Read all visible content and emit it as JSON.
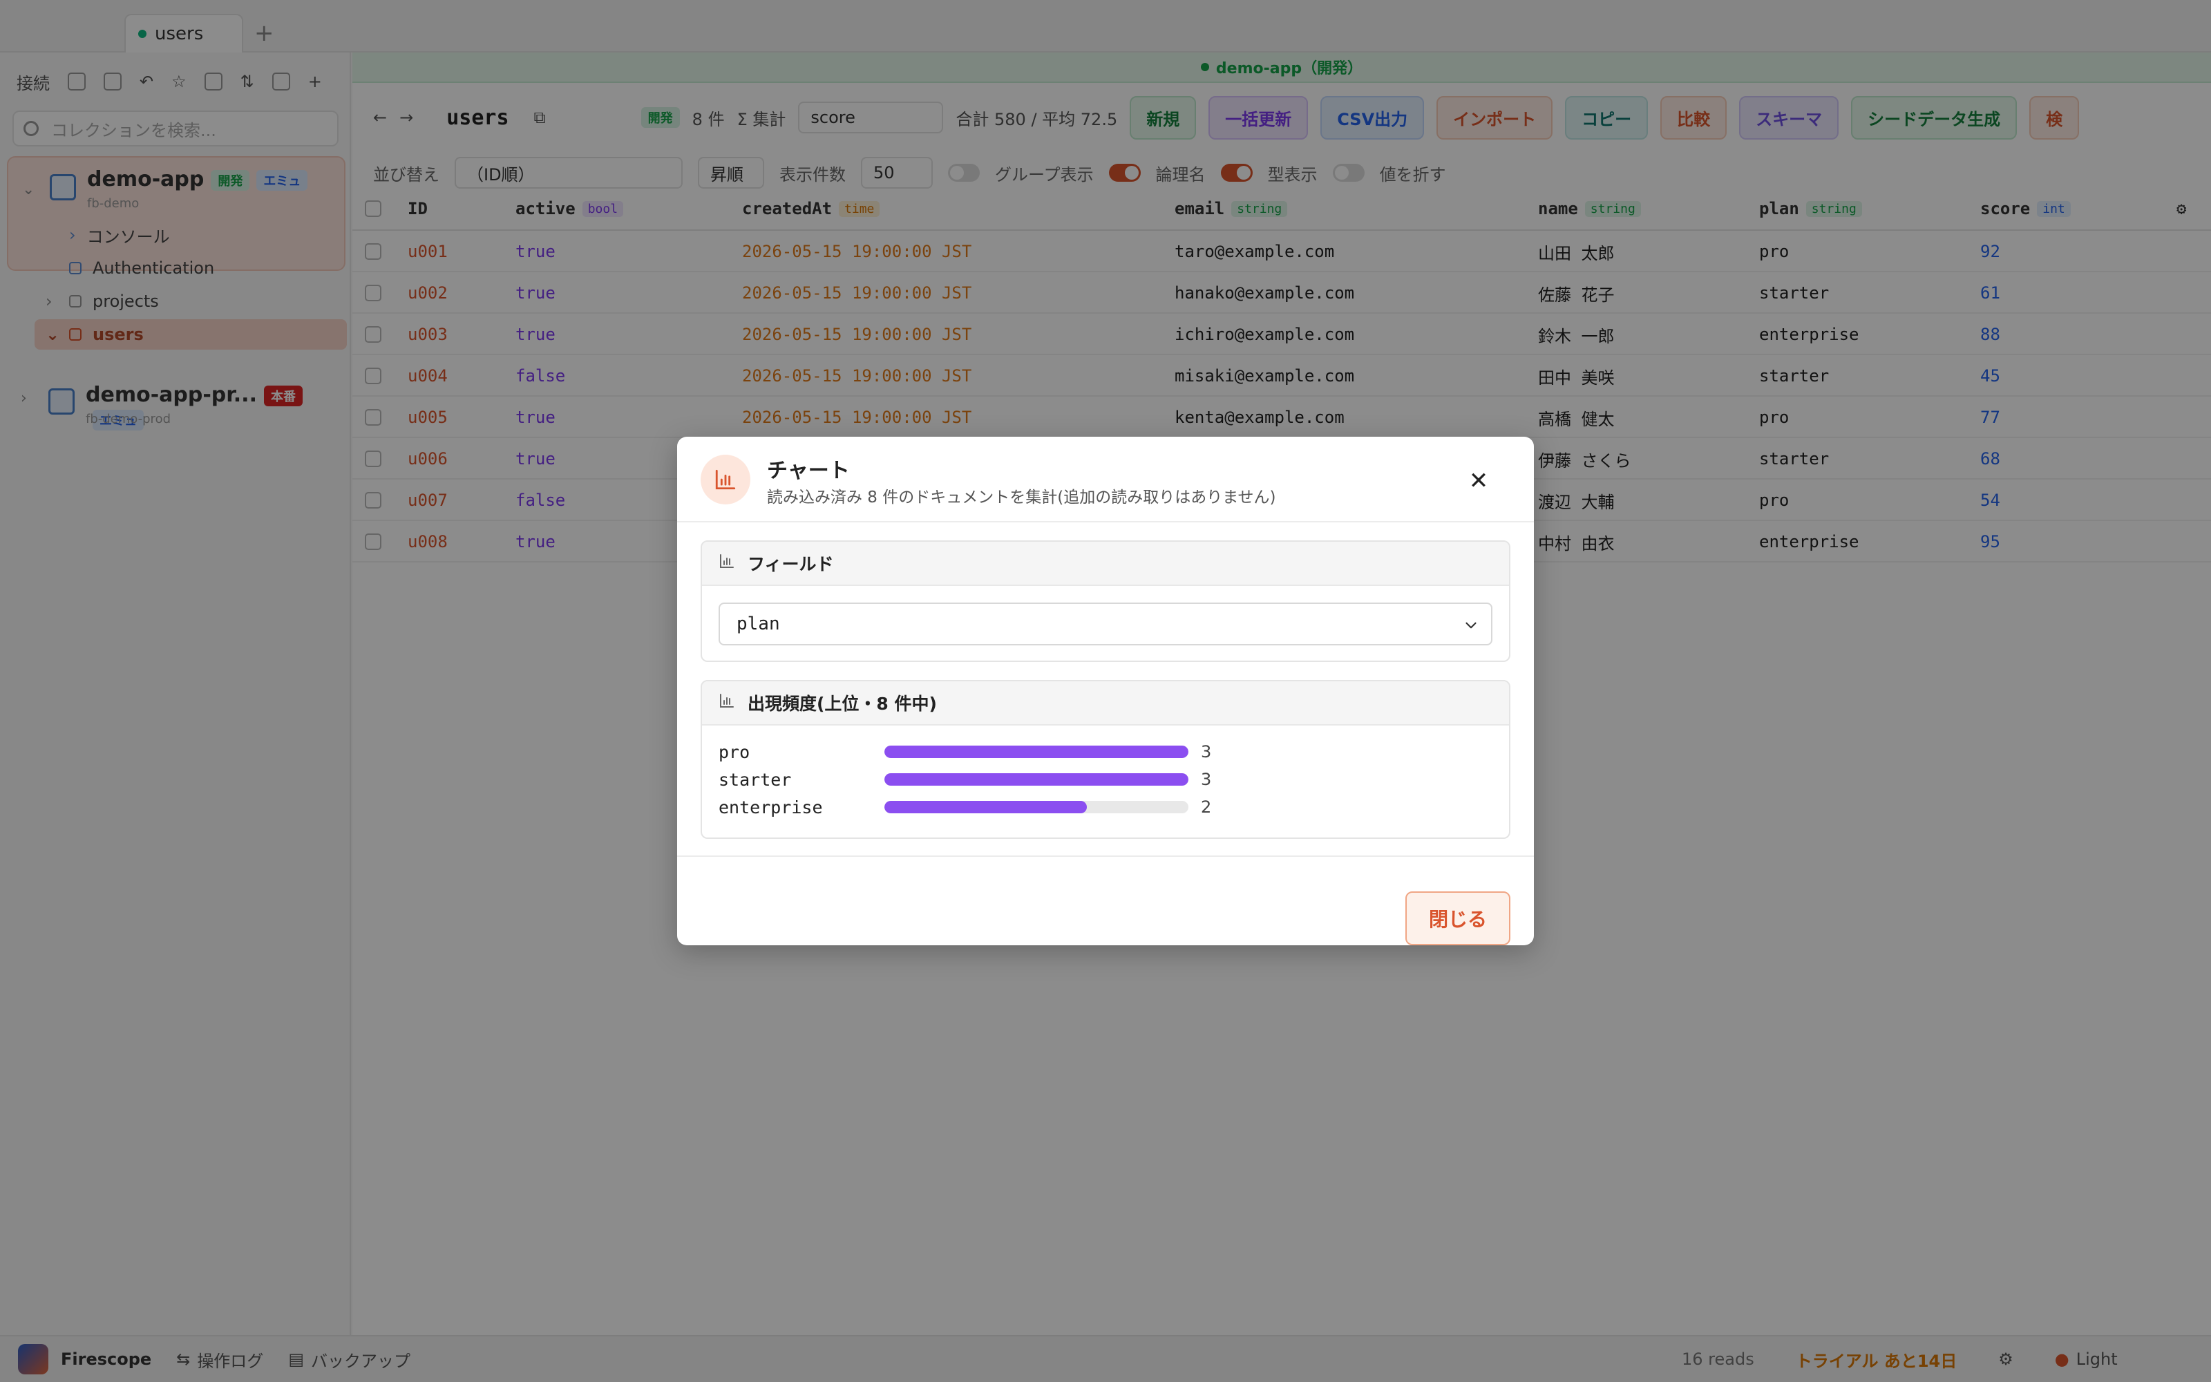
{
  "tabs": [
    {
      "label": "users"
    }
  ],
  "sidebar": {
    "toolbar_label": "接続",
    "search_placeholder": "コレクションを検索...",
    "projects": [
      {
        "name": "demo-app",
        "id": "fb-demo",
        "badges": [
          "開発",
          "エミュ"
        ]
      },
      {
        "name": "demo-app-pr...",
        "id": "fb-demo-prod",
        "badges": [
          "本番",
          "エミュ"
        ]
      }
    ],
    "tree": [
      {
        "label": "コンソール"
      },
      {
        "label": "Authentication"
      },
      {
        "label": "projects"
      },
      {
        "label": "users"
      }
    ]
  },
  "main": {
    "env_label": "demo-app（開発）",
    "collection_title": "users",
    "mode_badge": "開発",
    "doc_count": "8 件",
    "aggregate_label": "Σ 集計",
    "aggregate_field": "score",
    "aggregate_summary": "合計 580 / 平均 72.5",
    "actions": [
      "新規",
      "一括更新",
      "CSV出力",
      "インポート",
      "コピー",
      "比較",
      "スキーマ",
      "シードデータ生成",
      "検"
    ],
    "sort_label": "並び替え",
    "sort_value": "（ID順）",
    "order_value": "昇順",
    "page_size_label": "表示件数",
    "page_size_value": "50",
    "toggles": [
      {
        "label": "グループ表示",
        "on": false
      },
      {
        "label": "論理名",
        "on": true
      },
      {
        "label": "型表示",
        "on": true
      },
      {
        "label": "値を折す",
        "on": false
      }
    ],
    "columns": [
      {
        "name": "ID",
        "type": ""
      },
      {
        "name": "active",
        "type": "bool"
      },
      {
        "name": "createdAt",
        "type": "time"
      },
      {
        "name": "email",
        "type": "string"
      },
      {
        "name": "name",
        "type": "string"
      },
      {
        "name": "plan",
        "type": "string"
      },
      {
        "name": "score",
        "type": "int"
      }
    ],
    "rows": [
      {
        "id": "u001",
        "active": "true",
        "createdAt": "2026-05-15 19:00:00 JST",
        "email": "taro@example.com",
        "name": "山田 太郎",
        "plan": "pro",
        "score": "92"
      },
      {
        "id": "u002",
        "active": "true",
        "createdAt": "2026-05-15 19:00:00 JST",
        "email": "hanako@example.com",
        "name": "佐藤 花子",
        "plan": "starter",
        "score": "61"
      },
      {
        "id": "u003",
        "active": "true",
        "createdAt": "2026-05-15 19:00:00 JST",
        "email": "ichiro@example.com",
        "name": "鈴木 一郎",
        "plan": "enterprise",
        "score": "88"
      },
      {
        "id": "u004",
        "active": "false",
        "createdAt": "2026-05-15 19:00:00 JST",
        "email": "misaki@example.com",
        "name": "田中 美咲",
        "plan": "starter",
        "score": "45"
      },
      {
        "id": "u005",
        "active": "true",
        "createdAt": "2026-05-15 19:00:00 JST",
        "email": "kenta@example.com",
        "name": "高橋 健太",
        "plan": "pro",
        "score": "77"
      },
      {
        "id": "u006",
        "active": "true",
        "createdAt": "",
        "email": "",
        "name": "伊藤 さくら",
        "plan": "starter",
        "score": "68"
      },
      {
        "id": "u007",
        "active": "false",
        "createdAt": "",
        "email": "",
        "name": "渡辺 大輔",
        "plan": "pro",
        "score": "54"
      },
      {
        "id": "u008",
        "active": "true",
        "createdAt": "",
        "email": "",
        "name": "中村 由衣",
        "plan": "enterprise",
        "score": "95"
      }
    ]
  },
  "statusbar": {
    "app_name": "Firescope",
    "ops_log": "操作ログ",
    "backup": "バックアップ",
    "reads": "16 reads",
    "trial": "トライアル あと14日",
    "theme": "Light"
  },
  "modal": {
    "title": "チャート",
    "subtitle": "読み込み済み 8 件のドキュメントを集計(追加の読み取りはありません)",
    "field_section_title": "フィールド",
    "field_value": "plan",
    "freq_section_title": "出現頻度(上位・8 件中)",
    "close_label": "閉じる",
    "accent_color": "#8b4ef0"
  },
  "chart_data": {
    "type": "bar",
    "orientation": "horizontal",
    "title": "出現頻度(上位・8 件中)",
    "categories": [
      "pro",
      "starter",
      "enterprise"
    ],
    "values": [
      3,
      3,
      2
    ],
    "xlim": [
      0,
      3
    ]
  }
}
